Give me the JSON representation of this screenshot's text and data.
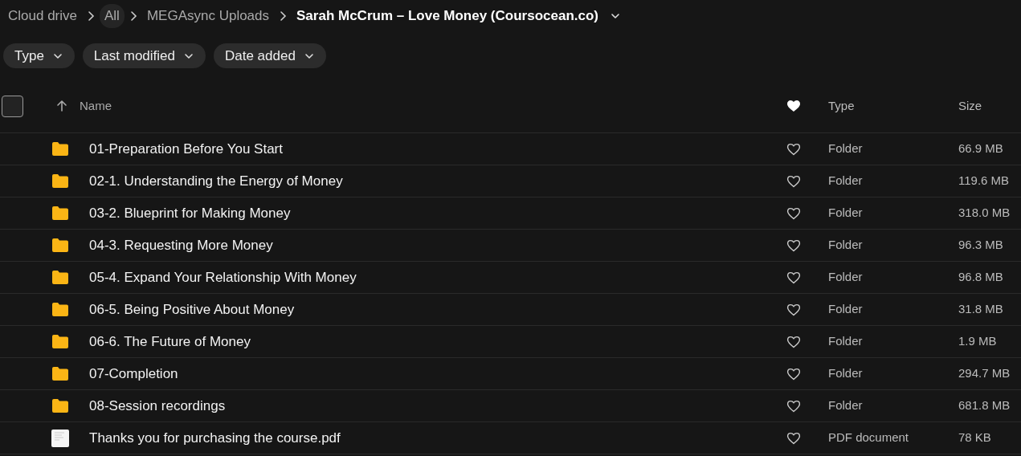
{
  "breadcrumb": [
    {
      "label": "Cloud drive",
      "selected": false,
      "current": false
    },
    {
      "label": "All",
      "selected": true,
      "current": false
    },
    {
      "label": "MEGAsync Uploads",
      "selected": false,
      "current": false
    },
    {
      "label": "Sarah McCrum – Love Money (Coursocean.co)",
      "selected": false,
      "current": true
    }
  ],
  "filters": [
    "Type",
    "Last modified",
    "Date added"
  ],
  "table": {
    "select_all": {
      "checked": false
    },
    "columns": [
      "Name",
      "Type",
      "Size"
    ],
    "rows": [
      {
        "kind": "folder",
        "name": "01-Preparation Before You Start",
        "favorite": false,
        "type": "Folder",
        "size": "66.9 MB"
      },
      {
        "kind": "folder",
        "name": "02-1. Understanding the Energy of Money",
        "favorite": false,
        "type": "Folder",
        "size": "119.6 MB"
      },
      {
        "kind": "folder",
        "name": "03-2. Blueprint for Making Money",
        "favorite": false,
        "type": "Folder",
        "size": "318.0 MB"
      },
      {
        "kind": "folder",
        "name": "04-3. Requesting More Money",
        "favorite": false,
        "type": "Folder",
        "size": "96.3 MB"
      },
      {
        "kind": "folder",
        "name": "05-4. Expand Your Relationship With Money",
        "favorite": false,
        "type": "Folder",
        "size": "96.8 MB"
      },
      {
        "kind": "folder",
        "name": "06-5. Being Positive About Money",
        "favorite": false,
        "type": "Folder",
        "size": "31.8 MB"
      },
      {
        "kind": "folder",
        "name": "06-6. The Future of Money",
        "favorite": false,
        "type": "Folder",
        "size": "1.9 MB"
      },
      {
        "kind": "folder",
        "name": "07-Completion",
        "favorite": false,
        "type": "Folder",
        "size": "294.7 MB"
      },
      {
        "kind": "folder",
        "name": "08-Session recordings",
        "favorite": false,
        "type": "Folder",
        "size": "681.8 MB"
      },
      {
        "kind": "pdf",
        "name": "Thanks you for purchasing the course.pdf",
        "favorite": false,
        "type": "PDF document",
        "size": "78 KB"
      }
    ]
  }
}
